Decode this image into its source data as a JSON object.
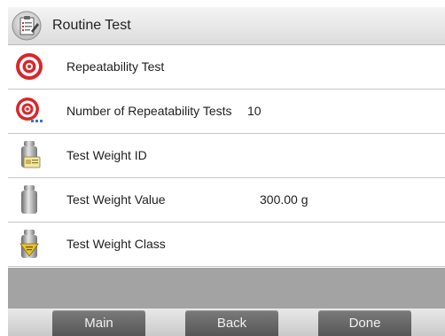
{
  "header": {
    "title": "Routine Test",
    "icon": "clipboard-checklist-icon"
  },
  "rows": [
    {
      "label": "Repeatability Test",
      "value": "",
      "icon": "target-icon"
    },
    {
      "label": "Number of Repeatability Tests",
      "value": "10",
      "icon": "target-count-icon"
    },
    {
      "label": "Test Weight ID",
      "value": "",
      "icon": "weight-id-icon"
    },
    {
      "label": "Test Weight Value",
      "value": "300.00 g",
      "icon": "weight-icon"
    },
    {
      "label": "Test Weight Class",
      "value": "",
      "icon": "weight-class-icon"
    }
  ],
  "buttons": {
    "main": "Main",
    "back": "Back",
    "done": "Done"
  },
  "colors": {
    "target_red": "#d8262b",
    "weight_gray": "#8c8c8c",
    "class_yellow": "#e8c430",
    "button_gray": "#6a6a6a"
  }
}
